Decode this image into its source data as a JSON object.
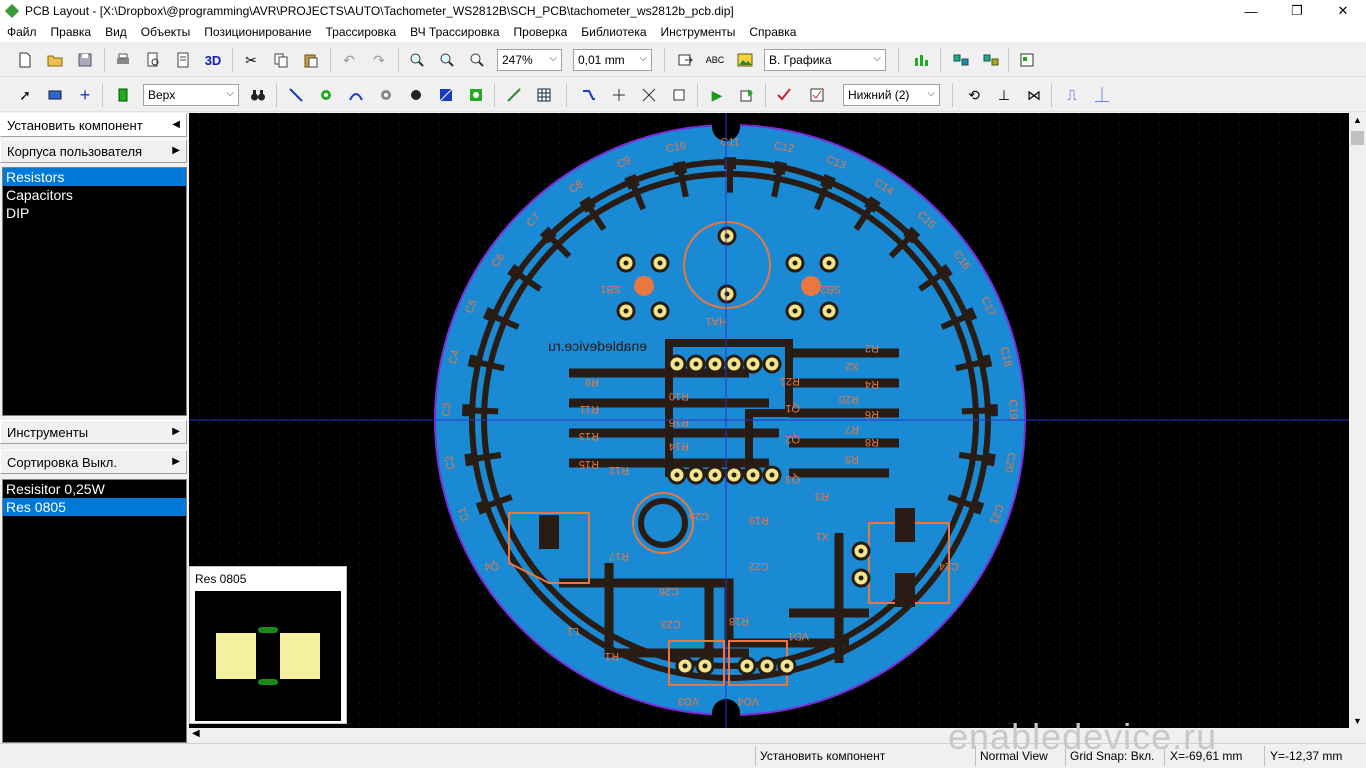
{
  "window": {
    "title": "PCB Layout - [X:\\Dropbox\\@programming\\AVR\\PROJECTS\\AUTO\\Tachometer_WS2812B\\SCH_PCB\\tachometer_ws2812b_pcb.dip]",
    "controls": {
      "minimize": "—",
      "maximize": "❐",
      "close": "✕"
    }
  },
  "menu": [
    "Файл",
    "Правка",
    "Вид",
    "Объекты",
    "Позиционирование",
    "Трассировка",
    "ВЧ Трассировка",
    "Проверка",
    "Библиотека",
    "Инструменты",
    "Справка"
  ],
  "toolbar1": {
    "btn_3d": "3D",
    "zoom": "247%",
    "grid": "0,01 mm",
    "abc": "ABC",
    "view_mode": "В. Графика"
  },
  "toolbar2": {
    "layer": "Верх",
    "side": "Нижний (2)"
  },
  "left_panel": {
    "install_component": "Установить компонент",
    "user_packages": "Корпуса пользователя",
    "package_list": [
      "Resistors",
      "Capacitors",
      "DIP"
    ],
    "tools": "Инструменты",
    "sorting": "Сортировка Выкл.",
    "component_list": [
      "Resisitor 0,25W",
      "Res 0805"
    ]
  },
  "preview": {
    "title": "Res 0805"
  },
  "pcb": {
    "watermark_text": "enabledevice.ru",
    "caps_outer": [
      "C1",
      "C2",
      "C3",
      "C4",
      "C5",
      "C6",
      "C7",
      "C8",
      "C9",
      "C10",
      "C11",
      "C12",
      "C13",
      "C14",
      "C15",
      "C16",
      "C17",
      "C18",
      "C19",
      "C20",
      "C21"
    ],
    "other_labels": [
      "SB1",
      "SB2",
      "HA1",
      "R2",
      "R4",
      "R6",
      "R8",
      "R9",
      "R10",
      "R11",
      "R12",
      "R13",
      "R14",
      "R15",
      "R16",
      "R17",
      "R18",
      "R19",
      "R21",
      "Q1",
      "Q2",
      "Q3",
      "Q4",
      "C22",
      "C23",
      "C24",
      "C25",
      "C26",
      "L1",
      "VD1",
      "VD3",
      "VD4",
      "X1",
      "X2",
      "R20",
      "R7",
      "R5",
      "R3",
      "R1"
    ]
  },
  "status": {
    "hint": "Установить компонент",
    "view": "Normal View",
    "snap": "Grid Snap: Вкл.",
    "x": "X=-69,61 mm",
    "y": "Y=-12,37 mm",
    "watermark": "enabledevice.ru"
  },
  "colors": {
    "board": "#1a8ad4",
    "copper": "#281c14",
    "silk": "#e87840",
    "pad_ring": "#f3e68a",
    "outline": "#7e2bdc",
    "crosshair": "#2a33c8"
  }
}
